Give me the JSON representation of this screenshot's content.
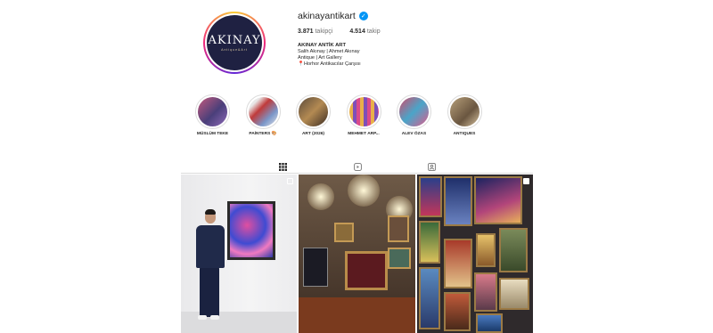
{
  "profile": {
    "username": "akinayantikart",
    "verified_icon": "verified-badge-icon",
    "avatar_logo": "AKINAY",
    "avatar_sub": "Antique&Art",
    "followers_count": "3.871",
    "followers_label": "takipçi",
    "following_count": "4.514",
    "following_label": "takip",
    "display_name": "AKINAY ANTİK ART",
    "bio_line1": "Salih Akınay | Ahmet Akınay",
    "bio_line2": "Antique | Art Gallery",
    "bio_pin": "📍",
    "bio_line3": "Horhor Antikacılar Çarşısı"
  },
  "highlights": [
    {
      "label": "MÜSLÜM TEKE",
      "colors": [
        "#c55a7d",
        "#4a3f7a"
      ]
    },
    {
      "label": "PAİNTERS",
      "emoji": "🎨",
      "colors": [
        "#c03a3a",
        "#7a96c9"
      ]
    },
    {
      "label": "ART (2026)",
      "colors": [
        "#5a4a3a",
        "#b38a52"
      ]
    },
    {
      "label": "MEHMET ARP...",
      "colors": [
        "#e8b04a",
        "#7e4fb8"
      ]
    },
    {
      "label": "ALEV ÖZAS",
      "colors": [
        "#d14a6a",
        "#4aa5c9"
      ]
    },
    {
      "label": "ANTIQUES",
      "colors": [
        "#b8a07a",
        "#6a5640"
      ]
    }
  ],
  "tabs": [
    {
      "name": "posts",
      "icon": "grid-icon",
      "active": true
    },
    {
      "name": "reels",
      "icon": "reels-icon",
      "active": false
    },
    {
      "name": "tagged",
      "icon": "tagged-icon",
      "active": false
    }
  ],
  "posts": [
    {
      "type": "carousel",
      "icon": "carousel-icon"
    },
    {
      "type": "image",
      "icon": ""
    },
    {
      "type": "reel",
      "icon": "reel-icon"
    }
  ],
  "colors": {
    "verified": "#0095f6",
    "avatar_bg": "#1f2142",
    "text": "#262626",
    "muted": "#737373",
    "divider": "#dbdbdb"
  }
}
